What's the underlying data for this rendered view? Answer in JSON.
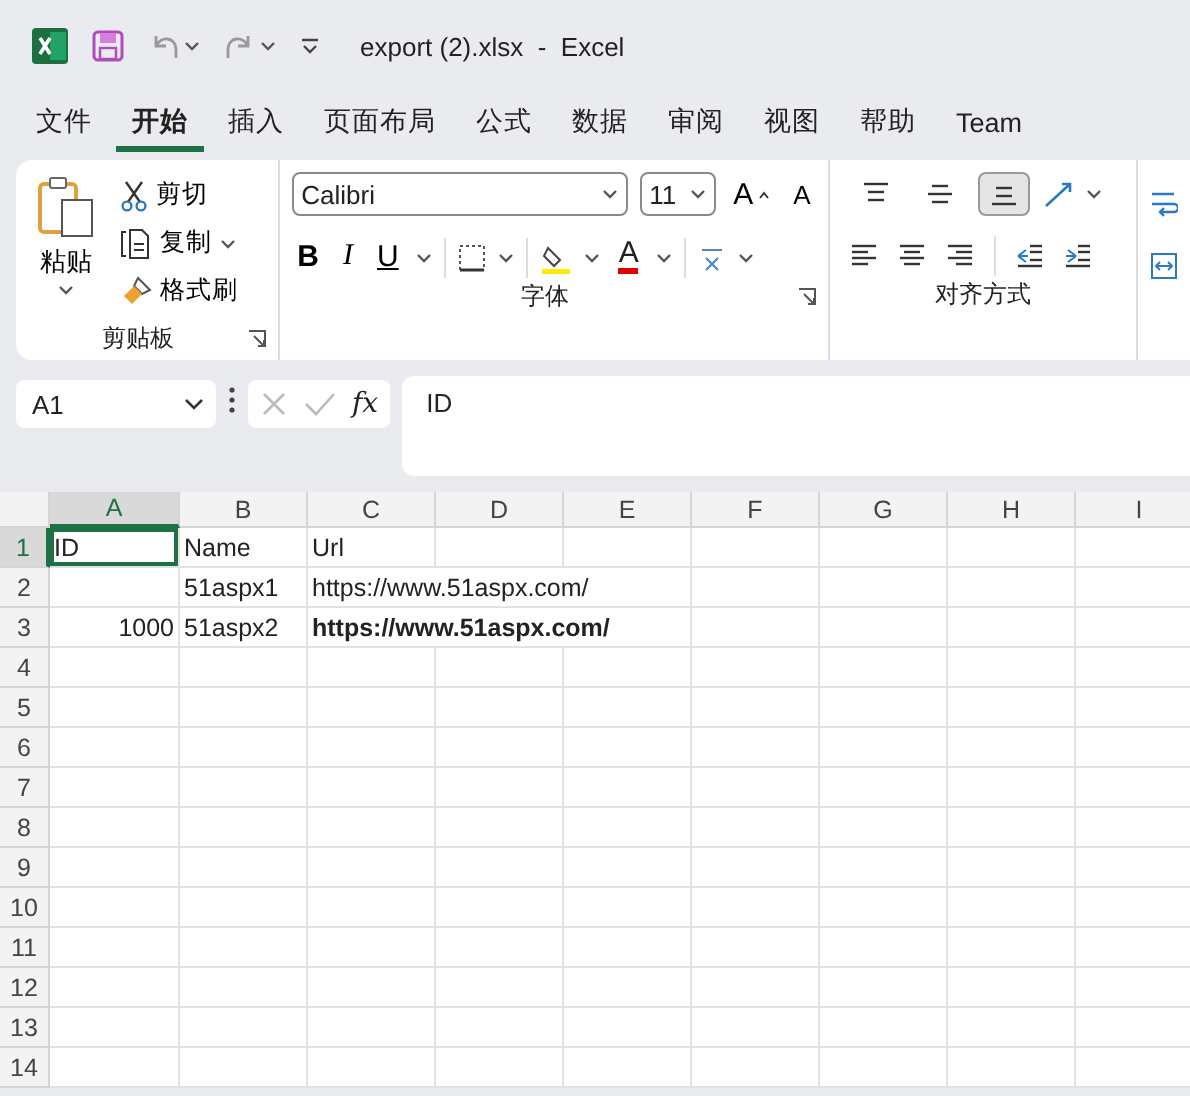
{
  "title_bar": {
    "title": "export (2).xlsx  -  Excel"
  },
  "tabs": [
    {
      "label": "文件",
      "selected": false
    },
    {
      "label": "开始",
      "selected": true
    },
    {
      "label": "插入",
      "selected": false
    },
    {
      "label": "页面布局",
      "selected": false
    },
    {
      "label": "公式",
      "selected": false
    },
    {
      "label": "数据",
      "selected": false
    },
    {
      "label": "审阅",
      "selected": false
    },
    {
      "label": "视图",
      "selected": false
    },
    {
      "label": "帮助",
      "selected": false
    },
    {
      "label": "Team",
      "selected": false
    }
  ],
  "ribbon": {
    "clipboard": {
      "paste": "粘贴",
      "cut": "剪切",
      "copy": "复制",
      "format_painter": "格式刷",
      "label": "剪贴板"
    },
    "font": {
      "font_name": "Calibri",
      "font_size": "11",
      "grow": "A",
      "shrink": "A",
      "bold": "B",
      "italic": "I",
      "underline": "U",
      "font_color": "A",
      "label": "字体"
    },
    "alignment": {
      "buttons": [
        {
          "kind": "top",
          "selected": false
        },
        {
          "kind": "middle",
          "selected": false
        },
        {
          "kind": "bottom",
          "selected": true
        }
      ],
      "label": "对齐方式"
    }
  },
  "formula_bar": {
    "name_box": "A1",
    "function_label": "fx",
    "formula": "ID"
  },
  "grid": {
    "columns": [
      {
        "label": "A",
        "selected": true
      },
      {
        "label": "B",
        "selected": false
      },
      {
        "label": "C",
        "selected": false
      },
      {
        "label": "D",
        "selected": false
      },
      {
        "label": "E",
        "selected": false
      },
      {
        "label": "F",
        "selected": false
      },
      {
        "label": "G",
        "selected": false
      },
      {
        "label": "H",
        "selected": false
      },
      {
        "label": "I",
        "selected": false
      }
    ],
    "rows": [
      {
        "header": "1",
        "selected": true,
        "cells": [
          {
            "text": "ID",
            "bold": false,
            "right_aligned": false,
            "selected": true
          },
          {
            "text": "Name",
            "bold": false,
            "right_aligned": false,
            "selected": false
          },
          {
            "text": "Url",
            "bold": false,
            "right_aligned": false,
            "selected": false
          }
        ]
      },
      {
        "header": "2",
        "selected": false,
        "cells": [
          {
            "selected": false
          },
          {
            "text": "51aspx1",
            "bold": false,
            "right_aligned": false,
            "selected": false
          },
          {
            "text": "https://www.51aspx.com/",
            "bold": false,
            "right_aligned": false,
            "selected": false
          }
        ]
      },
      {
        "header": "3",
        "selected": false,
        "cells": [
          {
            "text": "1000",
            "bold": false,
            "right_aligned": true,
            "selected": false
          },
          {
            "text": "51aspx2",
            "bold": false,
            "right_aligned": false,
            "selected": false
          },
          {
            "text": "https://www.51aspx.com/",
            "bold": true,
            "right_aligned": false,
            "selected": false
          }
        ]
      },
      {
        "header": "4",
        "selected": false
      },
      {
        "header": "5",
        "selected": false
      },
      {
        "header": "6",
        "selected": false
      },
      {
        "header": "7",
        "selected": false
      },
      {
        "header": "8",
        "selected": false
      },
      {
        "header": "9",
        "selected": false
      },
      {
        "header": "10",
        "selected": false
      },
      {
        "header": "11",
        "selected": false
      },
      {
        "header": "12",
        "selected": false
      },
      {
        "header": "13",
        "selected": false
      },
      {
        "header": "14",
        "selected": false
      }
    ]
  }
}
